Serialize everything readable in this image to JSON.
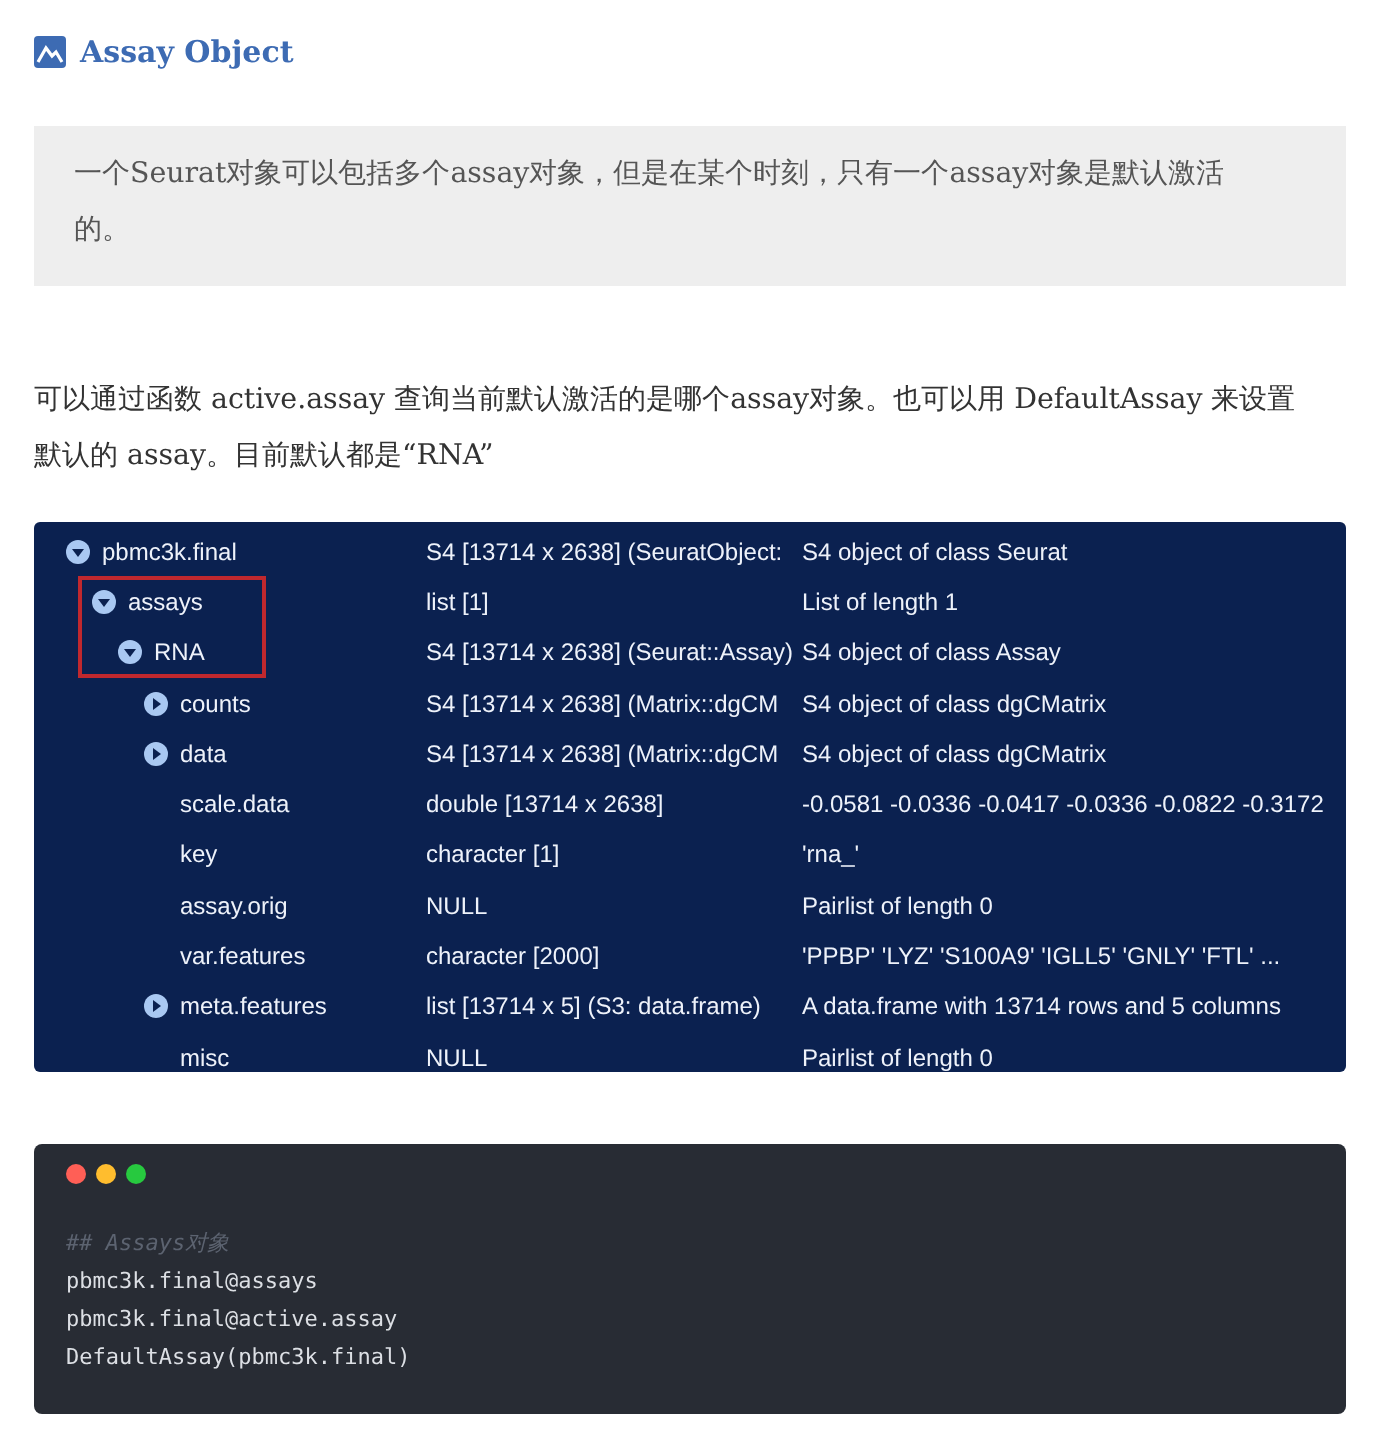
{
  "heading": {
    "text": "Assay Object"
  },
  "note": "一个Seurat对象可以包括多个assay对象，但是在某个时刻，只有一个assay对象是默认激活的。",
  "paragraph": "可以通过函数 active.assay 查询当前默认激活的是哪个assay对象。也可以用 DefaultAssay 来设置默认的 assay。目前默认都是“RNA”",
  "environment": {
    "nodes": [
      {
        "name": "pbmc3k.final",
        "type": "S4 [13714 x 2638] (SeuratObject:",
        "value": "S4 object of class Seurat",
        "expanded": true,
        "highlighted": false,
        "children": [
          {
            "name": "assays",
            "type": "list [1]",
            "value": "List of length 1",
            "expanded": true,
            "highlighted": true,
            "children": [
              {
                "name": "RNA",
                "type": "S4 [13714 x 2638] (Seurat::Assay)",
                "value": "S4 object of class Assay",
                "expanded": true,
                "highlighted": true,
                "children": [
                  {
                    "name": "counts",
                    "type": "S4 [13714 x 2638] (Matrix::dgCM",
                    "value": "S4 object of class dgCMatrix",
                    "expanded": false,
                    "highlighted": false
                  },
                  {
                    "name": "data",
                    "type": "S4 [13714 x 2638] (Matrix::dgCM",
                    "value": "S4 object of class dgCMatrix",
                    "expanded": false,
                    "highlighted": false
                  },
                  {
                    "name": "scale.data",
                    "type": "double [13714 x 2638]",
                    "value": "-0.0581 -0.0336 -0.0417 -0.0336 -0.0822 -0.3172",
                    "highlighted": false
                  },
                  {
                    "name": "key",
                    "type": "character [1]",
                    "value": "'rna_'",
                    "highlighted": false
                  },
                  {
                    "name": "assay.orig",
                    "type": "NULL",
                    "value": "Pairlist of length 0",
                    "highlighted": false
                  },
                  {
                    "name": "var.features",
                    "type": "character [2000]",
                    "value": "'PPBP' 'LYZ' 'S100A9' 'IGLL5' 'GNLY' 'FTL' ...",
                    "highlighted": false
                  },
                  {
                    "name": "meta.features",
                    "type": "list [13714 x 5] (S3: data.frame)",
                    "value": "A data.frame with 13714 rows and 5 columns",
                    "expanded": false,
                    "highlighted": false
                  },
                  {
                    "name": "misc",
                    "type": "NULL",
                    "value": "Pairlist of length 0",
                    "highlighted": false
                  }
                ]
              }
            ]
          }
        ]
      }
    ]
  },
  "code_block": {
    "lines": [
      {
        "kind": "comment",
        "text": "## Assays对象"
      },
      {
        "kind": "code",
        "text": "pbmc3k.final@assays"
      },
      {
        "kind": "code",
        "text": "pbmc3k.final@active.assay"
      },
      {
        "kind": "code",
        "text": "DefaultAssay(pbmc3k.final)"
      }
    ]
  }
}
